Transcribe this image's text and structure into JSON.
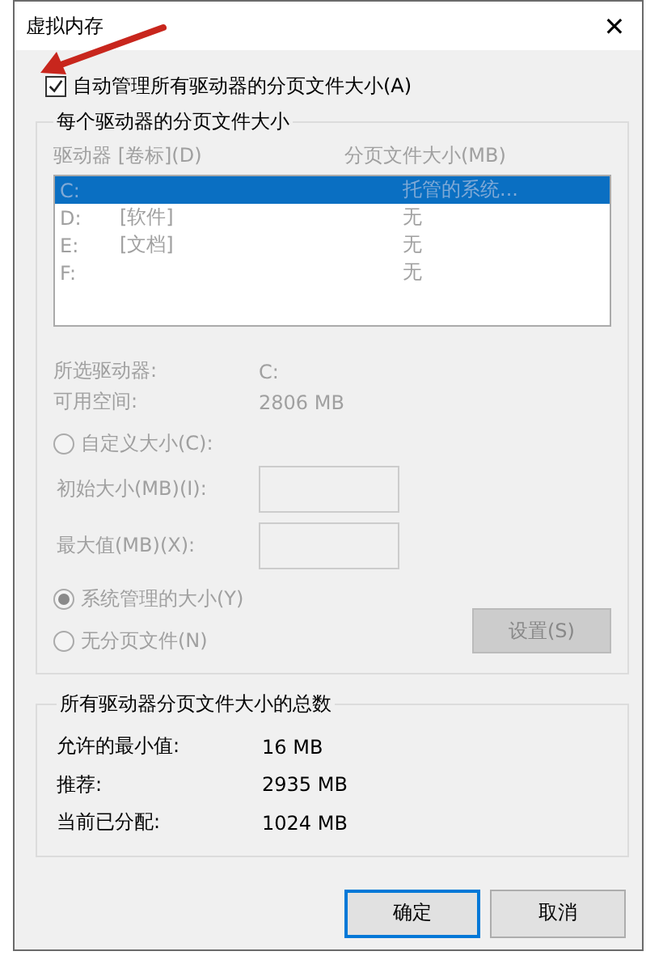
{
  "window": {
    "title": "虚拟内存",
    "close": "✕"
  },
  "auto_manage": {
    "label": "自动管理所有驱动器的分页文件大小(A)",
    "checked": true
  },
  "per_drive": {
    "title": "每个驱动器的分页文件大小",
    "disabled": true,
    "columns": [
      "驱动器 [卷标](D)",
      "分页文件大小(MB)"
    ],
    "rows": [
      {
        "drive": "C:",
        "label": "",
        "size": "托管的系统...",
        "selected": true
      },
      {
        "drive": "D:",
        "label": "[软件]",
        "size": "无",
        "selected": false
      },
      {
        "drive": "E:",
        "label": "[文档]",
        "size": "无",
        "selected": false
      },
      {
        "drive": "F:",
        "label": "",
        "size": "无",
        "selected": false
      }
    ],
    "info": [
      {
        "label": "所选驱动器:",
        "value": "C:"
      },
      {
        "label": "可用空间:",
        "value": "2806 MB"
      }
    ],
    "custom": {
      "label": "自定义大小(C):",
      "selected": false
    },
    "fields": [
      {
        "label": "初始大小(MB)(I):"
      },
      {
        "label": "最大值(MB)(X):"
      }
    ],
    "options": [
      {
        "label": "系统管理的大小(Y)",
        "selected": true
      },
      {
        "label": "无分页文件(N)",
        "selected": false
      }
    ],
    "set_button": "设置(S)"
  },
  "totals": {
    "title": "所有驱动器分页文件大小的总数",
    "rows": [
      {
        "label": "允许的最小值:",
        "value": "16 MB"
      },
      {
        "label": "推荐:",
        "value": "2935 MB"
      },
      {
        "label": "当前已分配:",
        "value": "1024 MB"
      }
    ]
  },
  "buttons": [
    {
      "label": "确定",
      "default": true
    },
    {
      "label": "取消",
      "default": false
    }
  ]
}
